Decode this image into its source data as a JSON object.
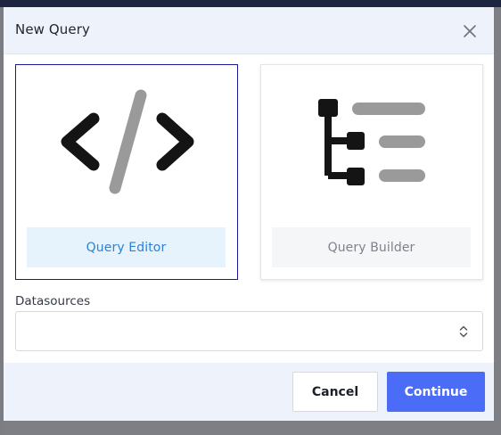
{
  "dialog": {
    "title": "New Query",
    "close_icon": "close-icon"
  },
  "options": [
    {
      "label": "Query Editor",
      "icon": "code-icon",
      "selected": true
    },
    {
      "label": "Query Builder",
      "icon": "tree-list-icon",
      "selected": false
    }
  ],
  "datasources": {
    "label": "Datasources",
    "value": "",
    "caret_icon": "chevron-up-down-icon"
  },
  "footer": {
    "cancel_label": "Cancel",
    "continue_label": "Continue"
  },
  "colors": {
    "accent": "#4a6cf7",
    "selected_border": "#1b1a93",
    "selected_label": "#2f80d6",
    "header_bg": "#eef3fb"
  }
}
